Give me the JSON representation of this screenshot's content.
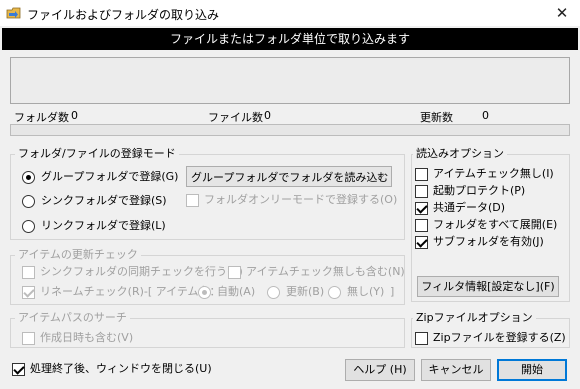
{
  "window": {
    "title": "ファイルおよびフォルダの取り込み",
    "close_glyph": "✕"
  },
  "banner": {
    "text": "ファイルまたはフォルダ単位で取り込みます"
  },
  "counts": {
    "folder_label": "フォルダ数",
    "folder_value": "0",
    "file_label": "ファイル数",
    "file_value": "0",
    "update_label": "更新数",
    "update_value": "0",
    "progress": 0
  },
  "register_mode": {
    "title": "フォルダ/ファイルの登録モード",
    "options": [
      "グループフォルダで登録(G)",
      "シンクフォルダで登録(S)",
      "リンクフォルダで登録(L)"
    ],
    "selected_index": 0,
    "dropdown_value": "グループフォルダでフォルダを読み込む",
    "folder_only_label": "フォルダオンリーモードで登録する(O)"
  },
  "item_update": {
    "title": "アイテムの更新チェック",
    "sync_check_label": "シンクフォルダの同期チェックを行う(K)",
    "no_check_label": "アイテムチェック無しも含む(N)",
    "rename_label": "リネームチェック(R)-[ アイテム名：",
    "rename_options": [
      "自動(A)",
      "更新(B)",
      "無し(Y)"
    ],
    "rename_close": "]"
  },
  "path_search": {
    "title": "アイテムパスのサーチ",
    "include_date_label": "作成日時も含む(V)"
  },
  "read_options": {
    "title": "読込みオプション",
    "items": [
      {
        "label": "アイテムチェック無し(I)",
        "checked": false
      },
      {
        "label": "起動プロテクト(P)",
        "checked": false
      },
      {
        "label": "共通データ(D)",
        "checked": true
      },
      {
        "label": "フォルダをすべて展開(E)",
        "checked": false
      },
      {
        "label": "サブフォルダを有効(J)",
        "checked": true
      }
    ],
    "filter_button": "フィルタ情報[設定なし](F)"
  },
  "zip_options": {
    "title": "Zipファイルオプション",
    "register_label": "Zipファイルを登録する(Z)"
  },
  "footer": {
    "close_after_label": "処理終了後、ウィンドウを閉じる(U)",
    "help_button": "ヘルプ (H)",
    "cancel_button": "キャンセル",
    "start_button": "開始"
  },
  "colors": {
    "banner_bg": "#000000",
    "primary_border": "#0078d7",
    "disabled_text": "#a0a0a0"
  },
  "icons": {
    "app": "folder-import-icon",
    "dropdown": "chevron-down-icon"
  }
}
